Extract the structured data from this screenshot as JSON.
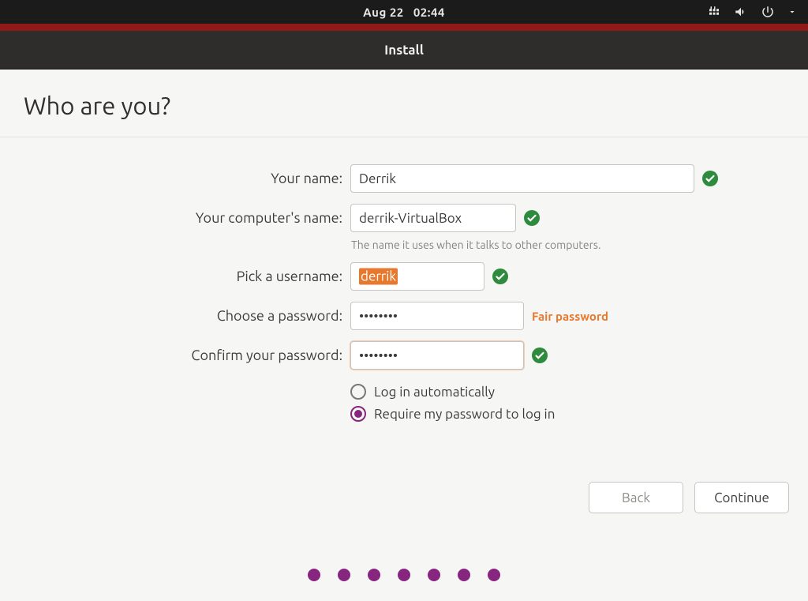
{
  "system": {
    "date": "Aug 22",
    "time": "02:44"
  },
  "window": {
    "title": "Install"
  },
  "heading": "Who are you?",
  "labels": {
    "name": "Your name:",
    "host": "Your computer's name:",
    "host_help": "The name it uses when it talks to other computers.",
    "user": "Pick a username:",
    "pw": "Choose a password:",
    "pw2": "Confirm your password:"
  },
  "values": {
    "name": "Derrik",
    "host": "derrik-VirtualBox",
    "user": "derrik",
    "pw": "••••••••",
    "pw2": "••••••••"
  },
  "pw_strength": "Fair password",
  "radios": {
    "auto": "Log in automatically",
    "require": "Require my password to log in"
  },
  "buttons": {
    "back": "Back",
    "continue": "Continue"
  }
}
